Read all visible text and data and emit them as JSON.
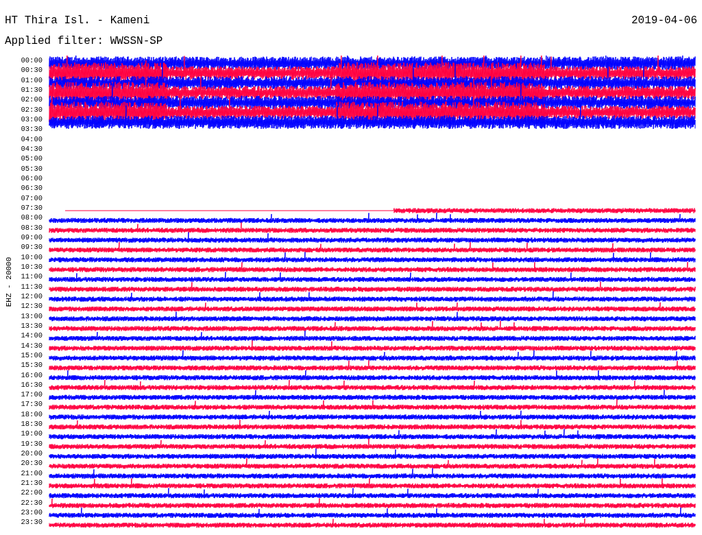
{
  "title": "HT Thira Isl. - Kameni",
  "date": "2019-04-06",
  "filter": "Applied filter: WWSSN-SP",
  "channel": "EHZ - 20000",
  "rows": [
    {
      "label": "00:00",
      "color": "#0000ff",
      "kind": "noisy"
    },
    {
      "label": "00:30",
      "color": "#ff0040",
      "kind": "noisy"
    },
    {
      "label": "01:00",
      "color": "#0000ff",
      "kind": "noisy"
    },
    {
      "label": "01:30",
      "color": "#ff0040",
      "kind": "noisy"
    },
    {
      "label": "02:00",
      "color": "#0000ff",
      "kind": "noisy"
    },
    {
      "label": "02:30",
      "color": "#ff0040",
      "kind": "noisy"
    },
    {
      "label": "03:00",
      "color": "#0000ff",
      "kind": "noisy"
    },
    {
      "label": "03:30",
      "kind": "empty"
    },
    {
      "label": "04:00",
      "kind": "empty"
    },
    {
      "label": "04:30",
      "kind": "empty"
    },
    {
      "label": "05:00",
      "kind": "empty"
    },
    {
      "label": "05:30",
      "kind": "empty"
    },
    {
      "label": "06:00",
      "kind": "empty"
    },
    {
      "label": "06:30",
      "kind": "empty"
    },
    {
      "label": "07:00",
      "kind": "empty"
    },
    {
      "label": "07:30",
      "color": "#ff0040",
      "kind": "partial"
    },
    {
      "label": "08:00",
      "color": "#0000ff",
      "kind": "normal"
    },
    {
      "label": "08:30",
      "color": "#ff0040",
      "kind": "normal"
    },
    {
      "label": "09:00",
      "color": "#0000ff",
      "kind": "normal"
    },
    {
      "label": "09:30",
      "color": "#ff0040",
      "kind": "normal"
    },
    {
      "label": "10:00",
      "color": "#0000ff",
      "kind": "normal"
    },
    {
      "label": "10:30",
      "color": "#ff0040",
      "kind": "normal"
    },
    {
      "label": "11:00",
      "color": "#0000ff",
      "kind": "normal"
    },
    {
      "label": "11:30",
      "color": "#ff0040",
      "kind": "normal"
    },
    {
      "label": "12:00",
      "color": "#0000ff",
      "kind": "normal"
    },
    {
      "label": "12:30",
      "color": "#ff0040",
      "kind": "normal"
    },
    {
      "label": "13:00",
      "color": "#0000ff",
      "kind": "normal"
    },
    {
      "label": "13:30",
      "color": "#ff0040",
      "kind": "normal"
    },
    {
      "label": "14:00",
      "color": "#0000ff",
      "kind": "normal"
    },
    {
      "label": "14:30",
      "color": "#ff0040",
      "kind": "normal"
    },
    {
      "label": "15:00",
      "color": "#0000ff",
      "kind": "normal"
    },
    {
      "label": "15:30",
      "color": "#ff0040",
      "kind": "normal"
    },
    {
      "label": "16:00",
      "color": "#0000ff",
      "kind": "normal"
    },
    {
      "label": "16:30",
      "color": "#ff0040",
      "kind": "normal"
    },
    {
      "label": "17:00",
      "color": "#0000ff",
      "kind": "normal"
    },
    {
      "label": "17:30",
      "color": "#ff0040",
      "kind": "normal"
    },
    {
      "label": "18:00",
      "color": "#0000ff",
      "kind": "normal"
    },
    {
      "label": "18:30",
      "color": "#ff0040",
      "kind": "normal"
    },
    {
      "label": "19:00",
      "color": "#0000ff",
      "kind": "normal"
    },
    {
      "label": "19:30",
      "color": "#ff0040",
      "kind": "normal"
    },
    {
      "label": "20:00",
      "color": "#0000ff",
      "kind": "normal"
    },
    {
      "label": "20:30",
      "color": "#ff0040",
      "kind": "normal"
    },
    {
      "label": "21:00",
      "color": "#0000ff",
      "kind": "normal"
    },
    {
      "label": "21:30",
      "color": "#ff0040",
      "kind": "normal"
    },
    {
      "label": "22:00",
      "color": "#0000ff",
      "kind": "normal"
    },
    {
      "label": "22:30",
      "color": "#ff0040",
      "kind": "normal"
    },
    {
      "label": "23:00",
      "color": "#0000ff",
      "kind": "normal"
    },
    {
      "label": "23:30",
      "color": "#ff0040",
      "kind": "normal"
    }
  ]
}
